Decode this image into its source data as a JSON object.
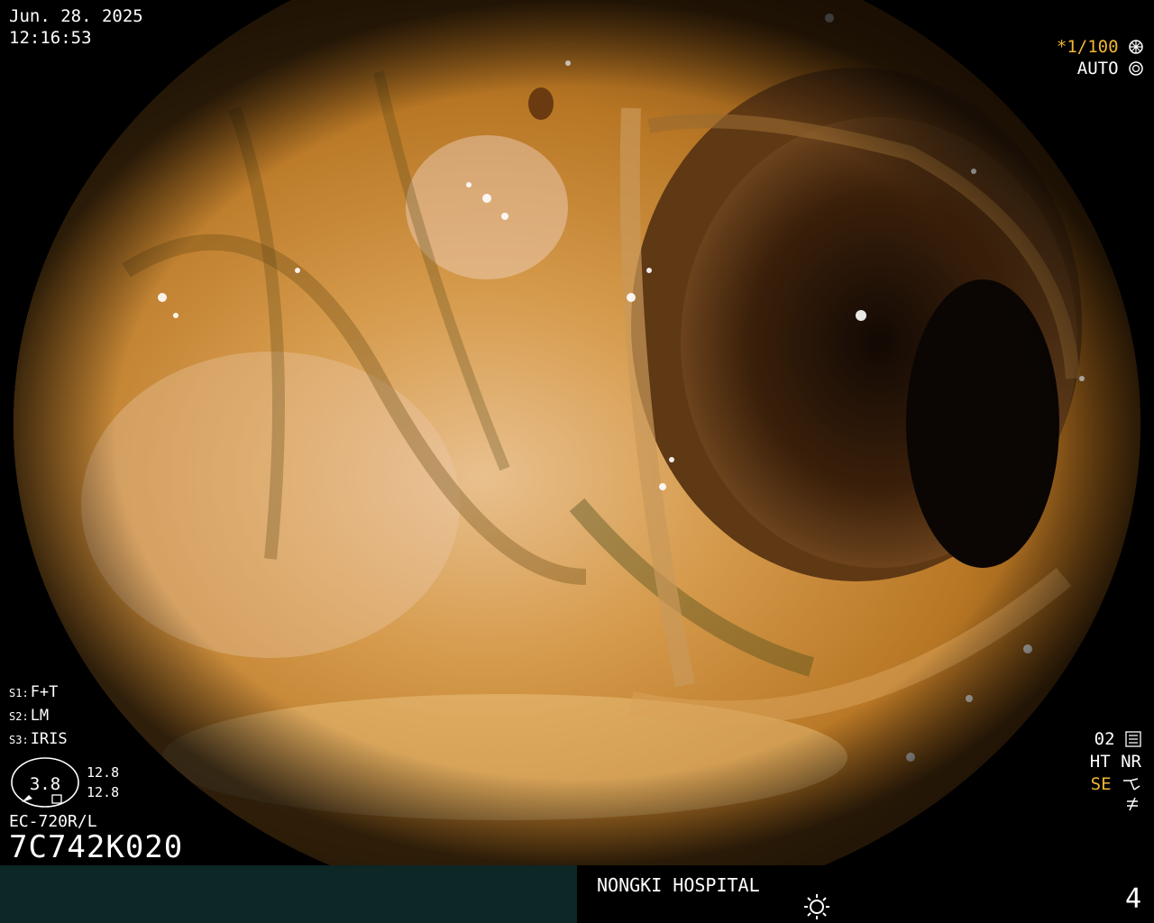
{
  "header": {
    "date": "Jun. 28. 2025",
    "time": "12:16:53"
  },
  "top_right": {
    "shutter": "*1/100",
    "shutter_icon": "shutter-icon",
    "mode": "AUTO",
    "mode_icon": "iris-icon"
  },
  "settings": [
    {
      "key": "S1:",
      "val": "F+T"
    },
    {
      "key": "S2:",
      "val": "LM"
    },
    {
      "key": "S3:",
      "val": "IRIS"
    }
  ],
  "gauge": {
    "value": "3.8",
    "a": "12.8",
    "b": "12.8"
  },
  "scope": {
    "model": "EC-720R/L",
    "serial": "7C742K020"
  },
  "bottom_right": {
    "o2": "02",
    "o2_icon": "menu-icon",
    "ht_nr": "HT NR",
    "se": "SE",
    "se_icon": "enhance-icon",
    "f_icon": "freeze-icon"
  },
  "footer": {
    "hospital": "NONGKI HOSPITAL",
    "light_icon": "sun-icon",
    "page": "4"
  },
  "colors": {
    "accent": "#f2b635",
    "footer_left": "#0d2626"
  }
}
